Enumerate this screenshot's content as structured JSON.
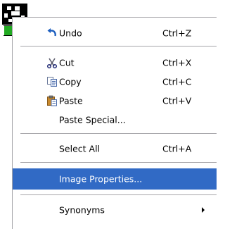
{
  "colors": {
    "highlight": "#316ac5",
    "separator": "#a7a6aa",
    "menu_bg": "#ffffff"
  },
  "menu": {
    "items": [
      {
        "label": "Undo",
        "shortcut": "Ctrl+Z",
        "icon": "undo-icon"
      },
      {
        "label": "Cut",
        "shortcut": "Ctrl+X",
        "icon": "scissors-icon"
      },
      {
        "label": "Copy",
        "shortcut": "Ctrl+C",
        "icon": "copy-icon"
      },
      {
        "label": "Paste",
        "shortcut": "Ctrl+V",
        "icon": "paste-icon"
      },
      {
        "label": "Paste Special..."
      },
      {
        "label": "Select All",
        "shortcut": "Ctrl+A"
      },
      {
        "label": "Image Properties...",
        "highlighted": true
      },
      {
        "label": "Synonyms",
        "submenu": true
      }
    ]
  }
}
